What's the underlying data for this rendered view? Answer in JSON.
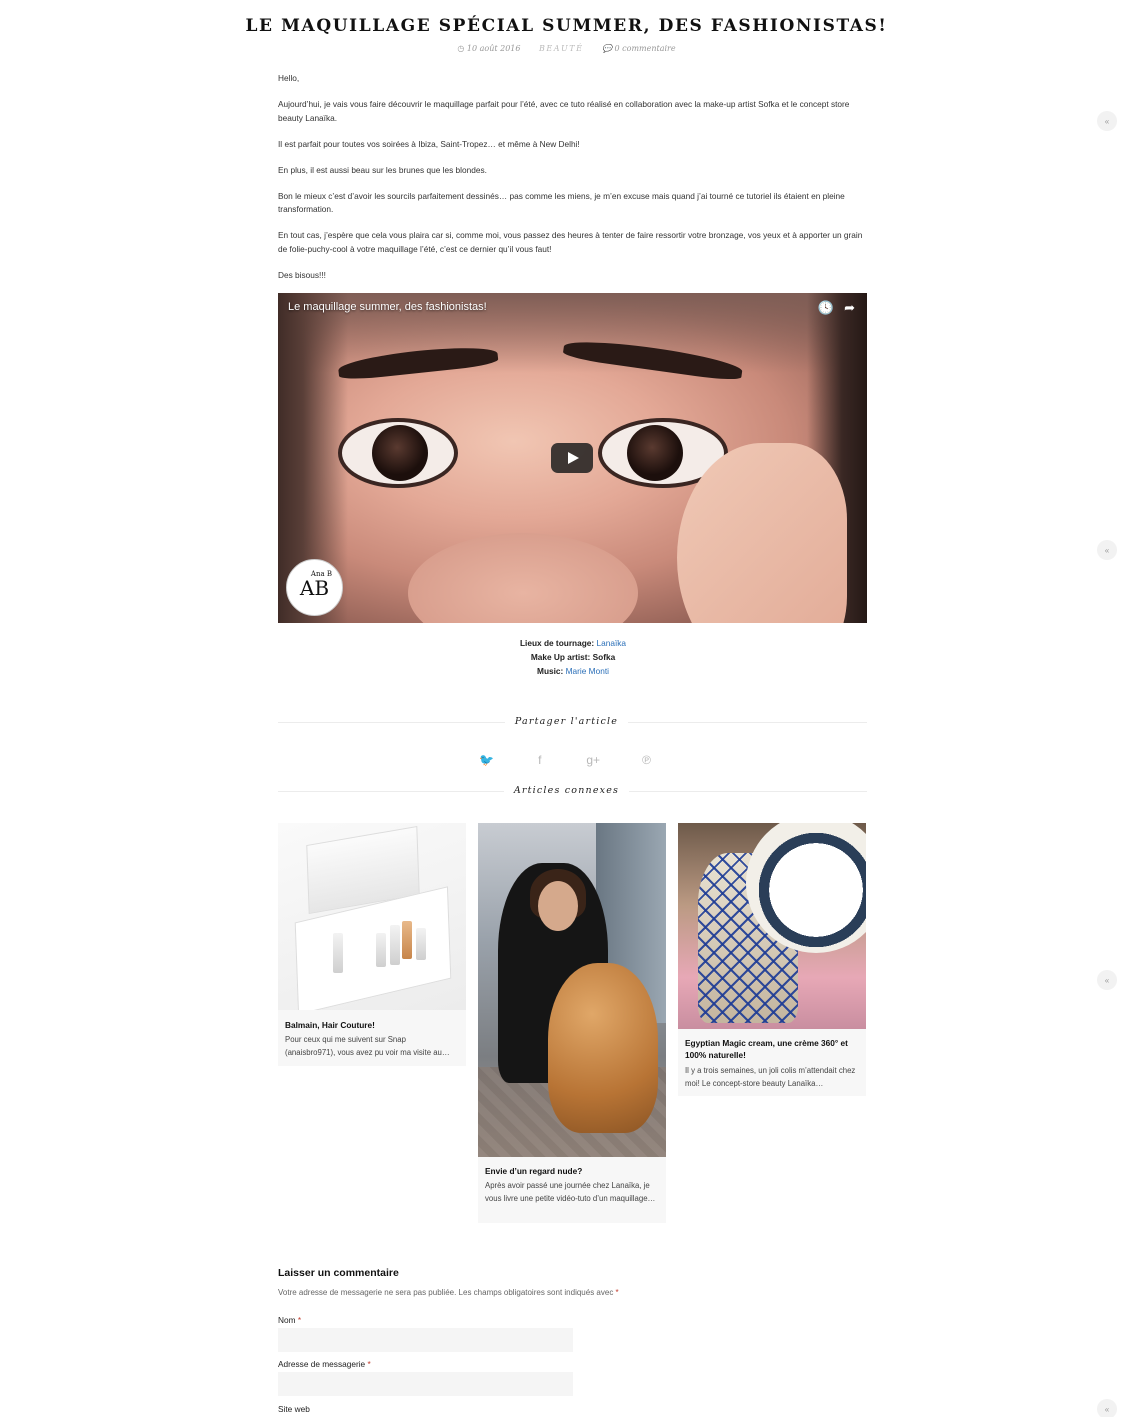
{
  "post": {
    "title": "LE MAQUILLAGE SPÉCIAL SUMMER, DES FASHIONISTAS!",
    "date": "10 août 2016",
    "category": "BEAUTÉ",
    "comments": "0 commentaire"
  },
  "content": {
    "p1": "Hello,",
    "p2": "Aujourd’hui, je vais vous faire découvrir le maquillage parfait pour l’été, avec ce tuto réalisé en collaboration avec la make-up artist Sofka et le concept store beauty Lanaïka.",
    "p3": "Il est parfait pour toutes vos soirées à Ibiza, Saint-Tropez… et même à New Delhi!",
    "p4": "En plus, il est aussi beau sur les brunes que les blondes.",
    "p5": "Bon le mieux c’est d’avoir les sourcils parfaitement dessinés… pas comme les miens, je m’en excuse mais quand j’ai tourné ce tutoriel ils étaient en pleine transformation.",
    "p6": "En tout cas, j’espère que cela vous plaira car si, comme moi, vous passez des heures à tenter de faire ressortir votre bronzage, vos yeux et à apporter un grain de folie-puchy-cool à votre maquillage l’été, c’est ce dernier qu’il vous faut!",
    "p7": "Des bisous!!!"
  },
  "video": {
    "title": "Le maquillage summer, des fashionistas!",
    "logo_text": "AB",
    "logo_small": "Ana B"
  },
  "credits": {
    "location_label": "Lieux de tournage:",
    "location_link": "Lanaïka",
    "makeup": "Make Up artist: Sofka",
    "music_label": "Music:",
    "music_link": "Marie Monti"
  },
  "share": {
    "heading": "Partager l'article",
    "twitter": "🐦",
    "facebook": "f",
    "google": "g+",
    "pinterest": "℗"
  },
  "related": {
    "heading": "Articles connexes",
    "items": [
      {
        "title": "Balmain, Hair Couture!",
        "excerpt": "Pour ceux qui me suivent sur Snap (anaisbro971), vous avez pu voir ma visite au…"
      },
      {
        "title": "Envie d’un regard nude?",
        "excerpt": "Après avoir passé une journée chez Lanaïka, je vous livre une petite vidéo-tuto d’un maquillage…"
      },
      {
        "title": "Egyptian Magic cream, une crème 360° et 100% naturelle!",
        "excerpt": "Il y a trois semaines, un joli colis m’attendait chez moi! Le concept-store beauty Lanaïka…"
      }
    ]
  },
  "comment_form": {
    "heading": "Laisser un commentaire",
    "note": "Votre adresse de messagerie ne sera pas publiée. Les champs obligatoires sont indiqués avec",
    "required_mark": "*",
    "name_label": "Nom",
    "email_label": "Adresse de messagerie",
    "website_label": "Site web"
  },
  "scroll_top": "«"
}
